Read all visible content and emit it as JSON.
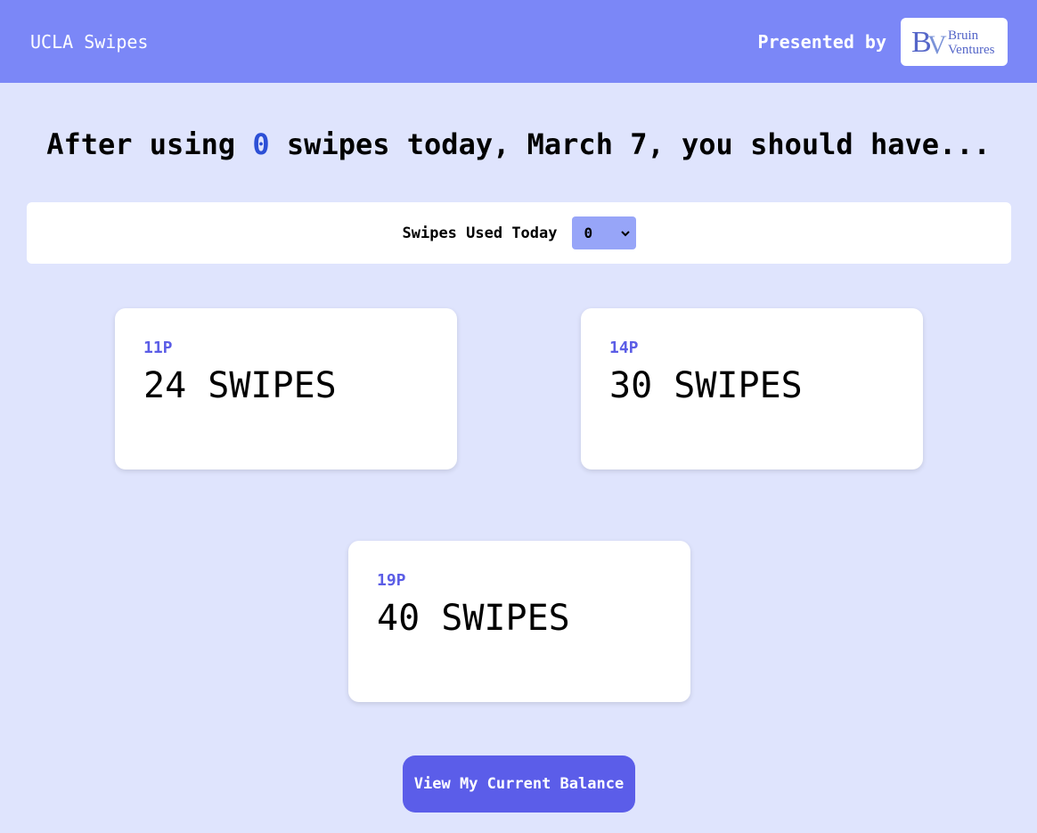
{
  "header": {
    "title": "UCLA Swipes",
    "presented_by": "Presented by",
    "logo_text": "BV Bruin Ventures"
  },
  "headline": {
    "prefix": "After using",
    "count": "0",
    "suffix": "swipes today, March 7, you should have..."
  },
  "selector": {
    "label": "Swipes Used Today",
    "value": "0"
  },
  "cards": [
    {
      "time": "11P",
      "value": "24 SWIPES"
    },
    {
      "time": "14P",
      "value": "30 SWIPES"
    },
    {
      "time": "19P",
      "value": "40 SWIPES"
    }
  ],
  "balance_button": "View My Current Balance",
  "colors": {
    "header": "#7b87f7",
    "background": "#dfe4fd",
    "accent": "#5b5de9",
    "highlight": "#2c4fd6"
  }
}
